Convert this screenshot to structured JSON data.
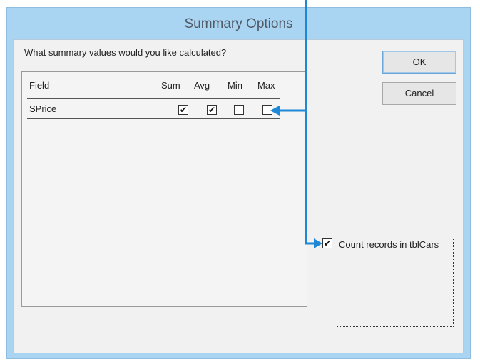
{
  "dialog": {
    "title": "Summary Options",
    "prompt": "What summary values would you like calculated?"
  },
  "table": {
    "headers": {
      "field": "Field",
      "sum": "Sum",
      "avg": "Avg",
      "min": "Min",
      "max": "Max"
    },
    "rows": [
      {
        "field": "SPrice",
        "sum": true,
        "avg": true,
        "min": false,
        "max": false
      }
    ]
  },
  "buttons": {
    "ok": "OK",
    "cancel": "Cancel"
  },
  "count_records": {
    "label": "Count records in tblCars",
    "checked": true
  },
  "colors": {
    "frame": "#a9d4f2",
    "arrow": "#1e88d6",
    "client": "#f1f1f1"
  },
  "checkmark_glyph": "✔"
}
